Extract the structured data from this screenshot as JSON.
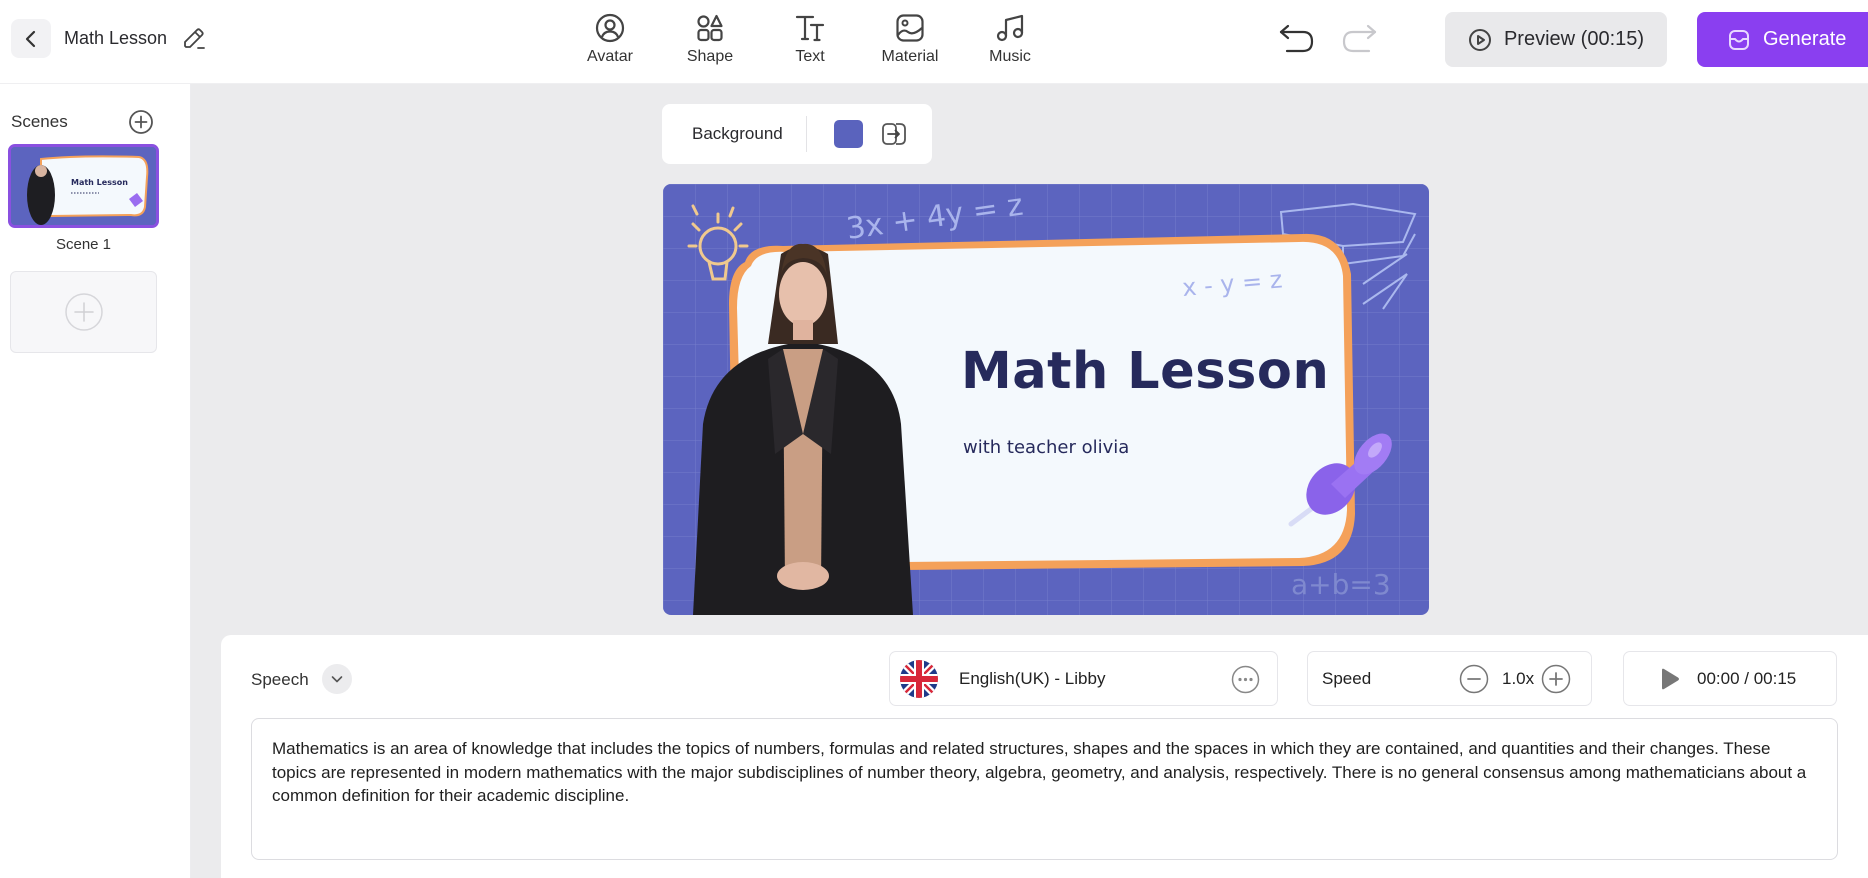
{
  "header": {
    "back_icon": "chevron-left-icon",
    "project_title": "Math Lesson",
    "edit_icon": "pencil-icon",
    "tools": [
      {
        "label": "Avatar",
        "icon": "avatar-icon"
      },
      {
        "label": "Shape",
        "icon": "shapes-icon"
      },
      {
        "label": "Text",
        "icon": "text-icon"
      },
      {
        "label": "Material",
        "icon": "image-icon"
      },
      {
        "label": "Music",
        "icon": "music-note-icon"
      }
    ],
    "undo_icon": "undo-icon",
    "redo_icon": "redo-icon",
    "preview_label": "Preview (00:15)",
    "generate_label": "Generate",
    "accent_color": "#8a3ff0"
  },
  "sidebar": {
    "title": "Scenes",
    "scenes": [
      {
        "label": "Scene 1",
        "thumb_title": "Math Lesson",
        "selected": true
      }
    ],
    "add_scene_icon": "plus-circle-icon"
  },
  "background_bar": {
    "label": "Background",
    "swatch_color": "#5a63bd",
    "apply_icon": "apply-to-all-icon"
  },
  "slide": {
    "title": "Math Lesson",
    "subtitle": "with teacher olivia",
    "bg_color": "#5c64bf",
    "card_color": "#f4f9fd",
    "frame_color": "#f4a15a",
    "doodles": [
      "3x + 4y = z",
      "x - y = z",
      "a+b=3"
    ]
  },
  "speech": {
    "label": "Speech",
    "voice": "English(UK) - Libby",
    "speed_label": "Speed",
    "speed_value": "1.0x",
    "time": "00:00 / 00:15",
    "script": "Mathematics is an area of knowledge that includes the topics of numbers, formulas and related structures, shapes and the spaces in which they are contained, and quantities and their changes. These topics are represented in modern mathematics with the major subdisciplines of number theory, algebra, geometry, and analysis, respectively. There is no general consensus among mathematicians about a common definition for their academic discipline."
  }
}
